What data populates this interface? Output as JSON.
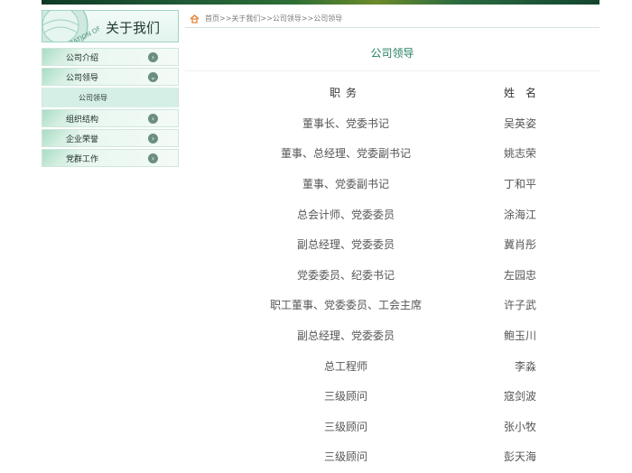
{
  "sidebar": {
    "logo_text": "CORPORATION OF",
    "title": "关于我们",
    "items": [
      {
        "label": "公司介绍"
      },
      {
        "label": "公司领导",
        "expanded": true
      },
      {
        "label": "组织结构"
      },
      {
        "label": "企业荣誉"
      },
      {
        "label": "党群工作"
      }
    ],
    "submenu_item": "公司领导"
  },
  "breadcrumb": {
    "home": "首页",
    "sep": ">>",
    "about": "关于我们",
    "leaders": "公司领导",
    "current": "公司领导"
  },
  "page_title": "公司领导",
  "table": {
    "headers": [
      "职务",
      "姓名"
    ],
    "rows": [
      [
        "董事长、党委书记",
        "吴英姿"
      ],
      [
        "董事、总经理、党委副书记",
        "姚志荣"
      ],
      [
        "董事、党委副书记",
        "丁和平"
      ],
      [
        "总会计师、党委委员",
        "涂海江"
      ],
      [
        "副总经理、党委委员",
        "冀肖彤"
      ],
      [
        "党委委员、纪委书记",
        "左园忠"
      ],
      [
        "职工董事、党委委员、工会主席",
        "许子武"
      ],
      [
        "副总经理、党委委员",
        "鲍玉川"
      ],
      [
        "总工程师",
        "李淼"
      ],
      [
        "三级顾问",
        "寇剑波"
      ],
      [
        "三级顾问",
        "张小牧"
      ],
      [
        "三级顾问",
        "彭天海"
      ]
    ]
  },
  "colors": {
    "accent_green": "#1f7d5c",
    "home_icon": "#e27a2a",
    "menu_arrow": "#6c8e80"
  }
}
